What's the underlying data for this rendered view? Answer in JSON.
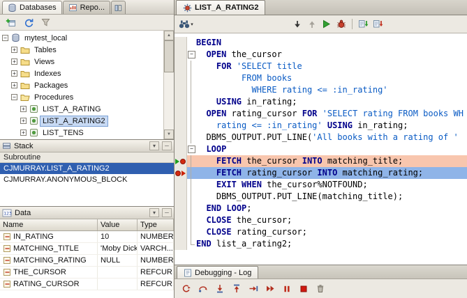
{
  "colors": {
    "selection_blue": "#2f5fb0",
    "tree_selection": "#c8daf4",
    "breakpoint_line_bg": "#f8c6ae",
    "current_line_bg": "#8fb4e8",
    "keyword_color": "#00008b",
    "string_color": "#0a5bc4",
    "run_green": "#33a033",
    "debug_red": "#c8402c"
  },
  "left_panel": {
    "tabs": [
      {
        "label": "Databases",
        "active": true,
        "icon": "database-icon"
      },
      {
        "label": "Repo...",
        "active": false,
        "icon": "reports-icon"
      },
      {
        "label": "",
        "active": false,
        "icon": "panels-icon"
      }
    ],
    "toolbar_icons": [
      "add-connection-icon",
      "refresh-icon",
      "filter-icon"
    ],
    "tree": {
      "items": [
        {
          "label": "mytest_local",
          "level": 0,
          "expand": "minus",
          "icon": "database-icon"
        },
        {
          "label": "Tables",
          "level": 1,
          "expand": "plus",
          "icon": "folder-icon"
        },
        {
          "label": "Views",
          "level": 1,
          "expand": "plus",
          "icon": "folder-icon"
        },
        {
          "label": "Indexes",
          "level": 1,
          "expand": "plus",
          "icon": "folder-icon"
        },
        {
          "label": "Packages",
          "level": 1,
          "expand": "plus",
          "icon": "folder-icon"
        },
        {
          "label": "Procedures",
          "level": 1,
          "expand": "minus",
          "icon": "folder-open-icon"
        },
        {
          "label": "LIST_A_RATING",
          "level": 2,
          "expand": "plus",
          "icon": "procedure-icon"
        },
        {
          "label": "LIST_A_RATING2",
          "level": 2,
          "expand": "plus",
          "icon": "procedure-icon",
          "selected": true
        },
        {
          "label": "LIST_TENS",
          "level": 2,
          "expand": "plus",
          "icon": "procedure-icon"
        }
      ]
    },
    "stack_panel": {
      "title": "Stack",
      "column_header": "Subroutine",
      "items": [
        {
          "label": "CJMURRAY.LIST_A_RATING2",
          "selected": true
        },
        {
          "label": "CJMURRAY.ANONYMOUS_BLOCK",
          "selected": false
        }
      ]
    },
    "data_panel": {
      "title": "Data",
      "columns": [
        "Name",
        "Value",
        "Type"
      ],
      "rows": [
        {
          "name": "IN_RATING",
          "value": "10",
          "type": "NUMBER"
        },
        {
          "name": "MATCHING_TITLE",
          "value": "'Moby Dick'",
          "type": "VARCH..."
        },
        {
          "name": "MATCHING_RATING",
          "value": "NULL",
          "type": "NUMBER"
        },
        {
          "name": "THE_CURSOR",
          "value": "",
          "type": "REFCUR..."
        },
        {
          "name": "RATING_CURSOR",
          "value": "",
          "type": "REFCUR..."
        }
      ]
    }
  },
  "editor": {
    "tab_label": "LIST_A_RATING2",
    "toolbar_icons": [
      "find-dropdown-icon",
      "navigate-next-icon",
      "navigate-previous-icon",
      "run-icon",
      "debug-icon",
      "compile-icon",
      "compile-for-debug-icon"
    ],
    "code_lines": [
      {
        "tokens": [
          [
            "k",
            "BEGIN"
          ]
        ]
      },
      {
        "fold": "box",
        "tokens": [
          [
            "p",
            "  "
          ],
          [
            "k",
            "OPEN"
          ],
          [
            "p",
            " the_cursor"
          ]
        ]
      },
      {
        "fold": "line",
        "tokens": [
          [
            "p",
            "    "
          ],
          [
            "k",
            "FOR"
          ],
          [
            "p",
            " "
          ],
          [
            "s",
            "'SELECT title"
          ]
        ]
      },
      {
        "fold": "line",
        "tokens": [
          [
            "s",
            "         FROM books"
          ]
        ]
      },
      {
        "fold": "line",
        "tokens": [
          [
            "s",
            "           WHERE rating <= :in_rating'"
          ]
        ]
      },
      {
        "fold": "line",
        "tokens": [
          [
            "p",
            "    "
          ],
          [
            "k",
            "USING"
          ],
          [
            "p",
            " in_rating;"
          ]
        ]
      },
      {
        "fold": "line",
        "tokens": [
          [
            "p",
            "  "
          ],
          [
            "k",
            "OPEN"
          ],
          [
            "p",
            " rating_cursor "
          ],
          [
            "k",
            "FOR"
          ],
          [
            "p",
            " "
          ],
          [
            "s",
            "'SELECT rating FROM books WH"
          ]
        ]
      },
      {
        "fold": "line",
        "tokens": [
          [
            "p",
            "    "
          ],
          [
            "s",
            "rating <= :in_rating'"
          ],
          [
            "p",
            " "
          ],
          [
            "k",
            "USING"
          ],
          [
            "p",
            " in_rating;"
          ]
        ]
      },
      {
        "fold": "line",
        "tokens": [
          [
            "p",
            "  DBMS_OUTPUT.PUT_LINE("
          ],
          [
            "s",
            "'All books with a rating of '"
          ]
        ]
      },
      {
        "fold": "box",
        "tokens": [
          [
            "p",
            "  "
          ],
          [
            "k",
            "LOOP"
          ]
        ]
      },
      {
        "fold": "line",
        "highlight": "breakpoint",
        "gutter": "exec-breakpoint",
        "tokens": [
          [
            "p",
            "    "
          ],
          [
            "k",
            "FETCH"
          ],
          [
            "p",
            " the_cursor "
          ],
          [
            "k",
            "INTO"
          ],
          [
            "p",
            " matching_title;"
          ]
        ]
      },
      {
        "fold": "line",
        "highlight": "current",
        "gutter": "breakpoint-arrow",
        "tokens": [
          [
            "p",
            "    "
          ],
          [
            "k",
            "FETCH"
          ],
          [
            "p",
            " rating_cursor "
          ],
          [
            "k",
            "INTO"
          ],
          [
            "p",
            " matching_rating;"
          ]
        ]
      },
      {
        "fold": "line",
        "tokens": [
          [
            "p",
            "    "
          ],
          [
            "k",
            "EXIT"
          ],
          [
            "p",
            " "
          ],
          [
            "k",
            "WHEN"
          ],
          [
            "p",
            " the_cursor%NOTFOUND;"
          ]
        ]
      },
      {
        "fold": "line",
        "tokens": [
          [
            "p",
            "    DBMS_OUTPUT.PUT_LINE(matching_title);"
          ]
        ]
      },
      {
        "fold": "line",
        "tokens": [
          [
            "p",
            "  "
          ],
          [
            "k",
            "END"
          ],
          [
            "p",
            " "
          ],
          [
            "k",
            "LOOP"
          ],
          [
            "p",
            ";"
          ]
        ]
      },
      {
        "fold": "line",
        "tokens": [
          [
            "p",
            "  "
          ],
          [
            "k",
            "CLOSE"
          ],
          [
            "p",
            " the_cursor;"
          ]
        ]
      },
      {
        "fold": "line",
        "tokens": [
          [
            "p",
            "  "
          ],
          [
            "k",
            "CLOSE"
          ],
          [
            "p",
            " rating_cursor;"
          ]
        ]
      },
      {
        "fold": "end",
        "tokens": [
          [
            "k",
            "END"
          ],
          [
            "p",
            " list_a_rating2;"
          ]
        ]
      }
    ]
  },
  "log_panel": {
    "tab_label": "Debugging - Log",
    "toolbar_icons": [
      "find-execution-point-icon",
      "step-over-icon",
      "step-into-icon",
      "step-out-icon",
      "step-to-end-icon",
      "resume-icon",
      "pause-icon",
      "terminate-icon",
      "delete-icon"
    ]
  }
}
